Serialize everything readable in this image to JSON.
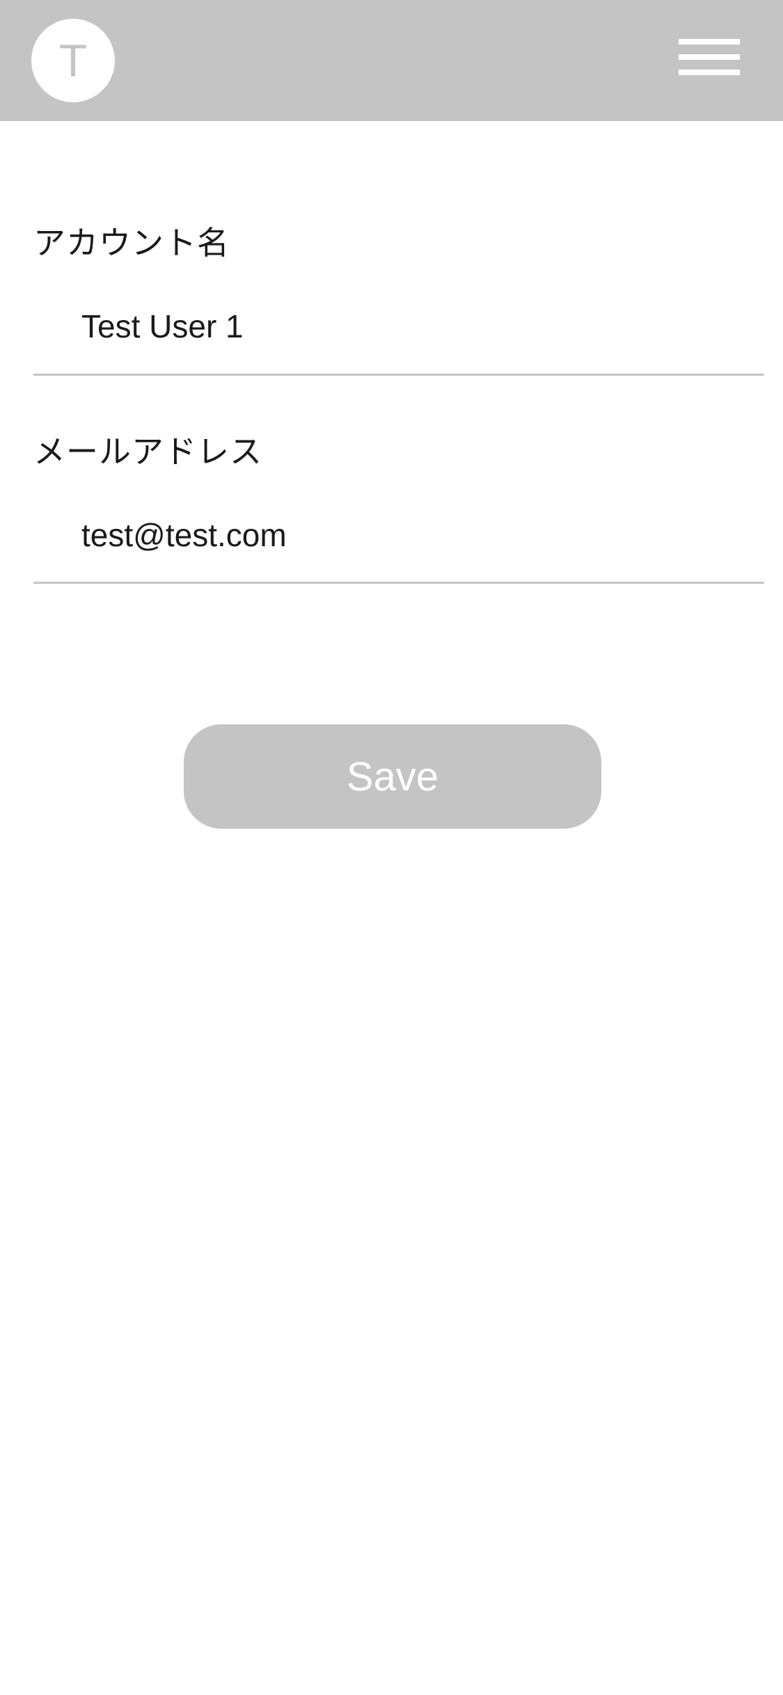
{
  "header": {
    "avatar_initial": "T",
    "menu_icon": "hamburger-menu-icon",
    "background_color": "#c4c4c4"
  },
  "form": {
    "account_name": {
      "label": "アカウント名",
      "value": "Test User 1"
    },
    "email": {
      "label": "メールアドレス",
      "value": "test@test.com"
    }
  },
  "actions": {
    "save_label": "Save"
  }
}
